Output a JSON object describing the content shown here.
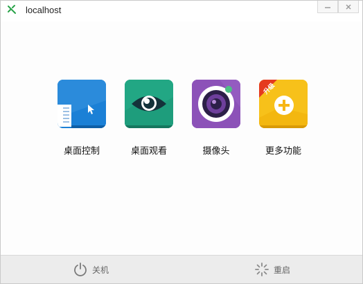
{
  "window": {
    "title": "localhost"
  },
  "apps": [
    {
      "name": "desktop-control",
      "label": "桌面控制",
      "icon": "desktop-control-icon",
      "color": "#1b80d6"
    },
    {
      "name": "desktop-view",
      "label": "桌面观看",
      "icon": "eye-icon",
      "color": "#22a784"
    },
    {
      "name": "camera",
      "label": "摄像头",
      "icon": "camera-lens-icon",
      "color": "#8c52b8"
    },
    {
      "name": "more-features",
      "label": "更多功能",
      "icon": "plus-icon",
      "color": "#f7c11a",
      "badge": "升级"
    }
  ],
  "footer": {
    "shutdown_label": "关机",
    "restart_label": "重启"
  }
}
